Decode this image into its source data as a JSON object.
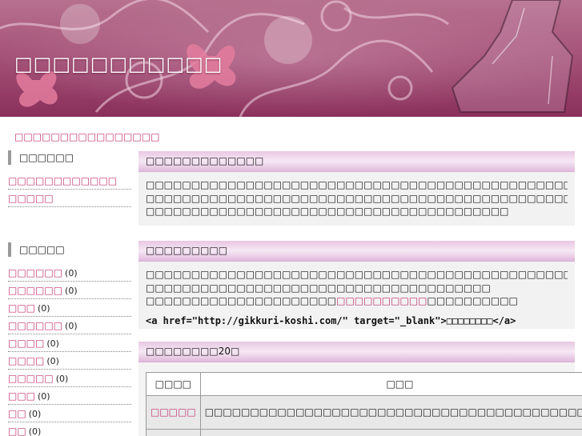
{
  "header": {
    "site_title": "□□□□□□□□□□□",
    "banner_colors": {
      "top": "#b7718f",
      "bottom": "#8a2f5b",
      "accent": "#e07b9b"
    }
  },
  "breadcrumb": "□□□□□□□□□□□□□□□□",
  "sidebar": {
    "menu_heading": "□□□□□□",
    "menu_items": [
      {
        "label": "□□□□□□□□□□□□"
      },
      {
        "label": "□□□□□"
      }
    ],
    "category_heading": "□□□□□",
    "categories": [
      {
        "label": "□□□□□□",
        "count": "(0)"
      },
      {
        "label": "□□□□□□",
        "count": "(0)"
      },
      {
        "label": "□□□",
        "count": "(0)"
      },
      {
        "label": "□□□□□□",
        "count": "(0)"
      },
      {
        "label": "□□□□",
        "count": "(0)"
      },
      {
        "label": "□□□□",
        "count": "(0)"
      },
      {
        "label": "□□□□□",
        "count": "(0)"
      },
      {
        "label": "□□□",
        "count": "(0)"
      },
      {
        "label": "□□",
        "count": "(0)"
      },
      {
        "label": "□□",
        "count": "(0)"
      }
    ]
  },
  "main": {
    "section1": {
      "heading": "□□□□□□□□□□□□□",
      "lines": [
        "□□□□□□□□□□□□□□□□□□□□□□□□□□□□□□□□□□□□□□□□□□□□□□□□□□□□□□□□□□",
        "□□□□□□□□□□□□□□□□□□□□□□□□□□□□□□□□□□□□□□□□□□□□□□□□□□□□□□□□□□",
        "□□□□□□□□□□□□□□□□□□□□□□□□□□□□□□□□□□□□□□□□"
      ]
    },
    "section2": {
      "heading": "□□□□□□□□□",
      "line1": "□□□□□□□□□□□□□□□□□□□□□□□□□□□□□□□□□□□□□□□□□□□□□□□□□□",
      "line2": "□□□□□□□□□□□□□□□□□□□□□□□□□□□□□□□□□□□□□□",
      "line3_before": "□□□□□□□□□□□□□□□□□□□□□",
      "line3_link": "□□□□□□□□□□",
      "line3_after": "□□□□□□□□□□",
      "code_before": "<a href=\"http://gikkuri-koshi.com/\" target=\"_blank\">",
      "code_text": "□□□□□□□□",
      "code_after": "</a>"
    },
    "section3": {
      "heading": "□□□□□□□□20□",
      "table": {
        "headers": [
          "□□□□",
          "□□□",
          "□□□□□"
        ],
        "rows": [
          {
            "name": "□□□□□",
            "desc": "□□□□□□□□□□□□□□□□□□□□□□□□□□□□□□□□□□□□□□□□□□□",
            "area": "□□□"
          },
          {
            "name": "",
            "desc": "□□□□□□□□□□□□□□□□□□□□□□□□□□□□□□□□□□□□□□",
            "area": ""
          }
        ]
      }
    }
  }
}
